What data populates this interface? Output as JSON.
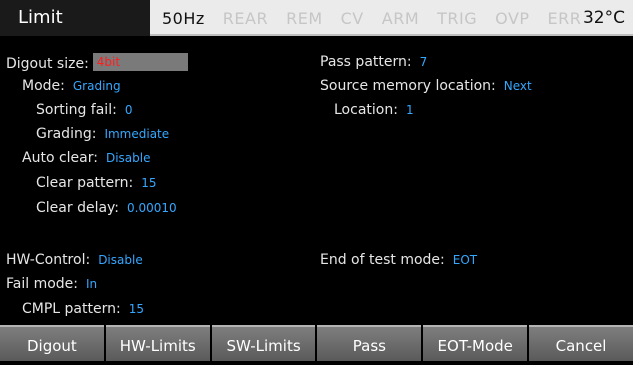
{
  "header": {
    "page_title": "Limit",
    "indicators": [
      {
        "label": "50Hz",
        "active": true
      },
      {
        "label": "REAR",
        "active": false
      },
      {
        "label": "REM",
        "active": false
      },
      {
        "label": "CV",
        "active": false
      },
      {
        "label": "ARM",
        "active": false
      },
      {
        "label": "TRIG",
        "active": false
      },
      {
        "label": "OVP",
        "active": false
      },
      {
        "label": "ERR",
        "active": false
      }
    ],
    "temperature": "32°C"
  },
  "settings": {
    "digout_size": {
      "label": "Digout size:",
      "value": "4bit"
    },
    "mode": {
      "label": "Mode:",
      "value": "Grading"
    },
    "sorting_fail": {
      "label": "Sorting fail:",
      "value": "0"
    },
    "grading": {
      "label": "Grading:",
      "value": "Immediate"
    },
    "auto_clear": {
      "label": "Auto clear:",
      "value": "Disable"
    },
    "clear_pattern": {
      "label": "Clear pattern:",
      "value": "15"
    },
    "clear_delay": {
      "label": "Clear delay:",
      "value": "0.00010"
    },
    "hw_control": {
      "label": "HW-Control:",
      "value": "Disable"
    },
    "fail_mode": {
      "label": "Fail mode:",
      "value": "In"
    },
    "cmpl_pattern": {
      "label": "CMPL pattern:",
      "value": "15"
    },
    "pass_pattern": {
      "label": "Pass pattern:",
      "value": "7"
    },
    "source_memory_location": {
      "label": "Source memory location:",
      "value": "Next"
    },
    "location": {
      "label": "Location:",
      "value": "1"
    },
    "end_of_test_mode": {
      "label": "End of test mode:",
      "value": "EOT"
    }
  },
  "softkeys": [
    "Digout",
    "HW-Limits",
    "SW-Limits",
    "Pass",
    "EOT-Mode",
    "Cancel"
  ],
  "colors": {
    "value": "#35a7ff",
    "digout_value": "#ff1d1d",
    "header_bg": "#ebebeb"
  }
}
